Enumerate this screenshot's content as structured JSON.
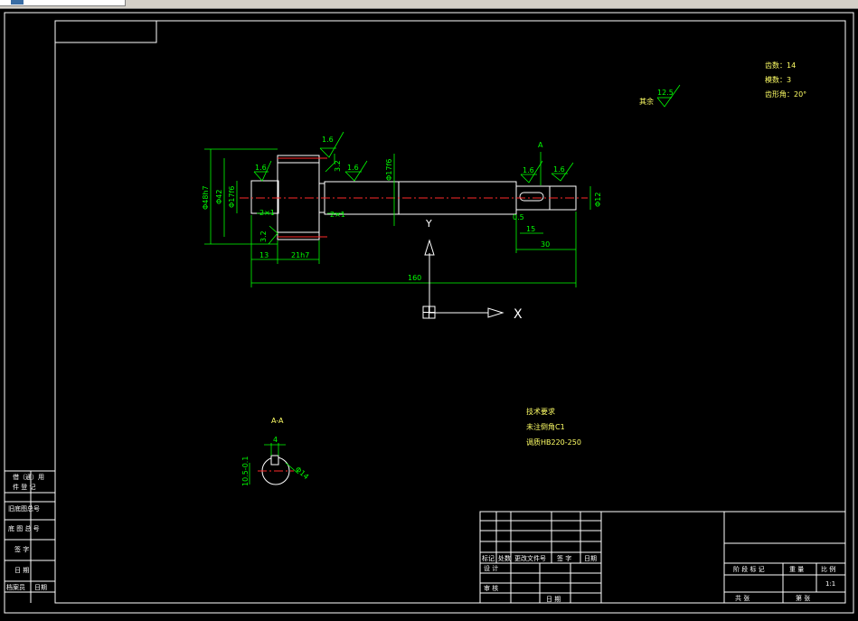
{
  "gear_params": {
    "teeth": "齿数：14",
    "module": "模数：3",
    "pressure_angle": "齿形角：20°"
  },
  "roughness": {
    "rest_label": "其余",
    "rest_value": "12.5",
    "v1": "1.6",
    "v2": "1.6",
    "v3": "1.6",
    "v4": "1.6",
    "v5": "3.2",
    "v6": "3.2",
    "v7": "1.6"
  },
  "dims": {
    "d_tip": "Φ48h7",
    "d_gear": "Φ42",
    "d_journal1": "Φ17f6",
    "d_mid": "Φ17f6",
    "d_end": "Φ12",
    "chamfer1": "2×1",
    "chamfer2": "2×1",
    "chamfer3": "0.5",
    "len_13": "13",
    "len_21": "21h7",
    "len_15": "15",
    "len_30": "30",
    "len_total": "160",
    "section_mark": "A"
  },
  "section": {
    "title": "A-A",
    "w": "4",
    "depth": "10.5-0.1",
    "dia": "Φ14"
  },
  "tech_req": {
    "title": "技术要求",
    "line1": "未注倒角C1",
    "line2": "调质HB220-250"
  },
  "ucs": {
    "x_label": "X",
    "y_label": "Y"
  },
  "left_strip": {
    "r1": "借（通）用",
    "r2": "件 登 记",
    "r3": "旧底图总号",
    "r4": "底 图 总 号",
    "r5": "签  字",
    "r6": "日  期",
    "r7a": "档案员",
    "r7b": "日期"
  },
  "title_block": {
    "mark": "标记",
    "qty": "处数",
    "change_doc": "更改文件号",
    "sign": "签 字",
    "date": "日期",
    "design": "设 计",
    "check": "审 核",
    "date2": "日 期",
    "stage": "阶 段 标 记",
    "weight": "重 量",
    "scale": "比 例",
    "scale_val": "1:1",
    "sheets_total": "共     张",
    "sheet_no": "第     张"
  }
}
